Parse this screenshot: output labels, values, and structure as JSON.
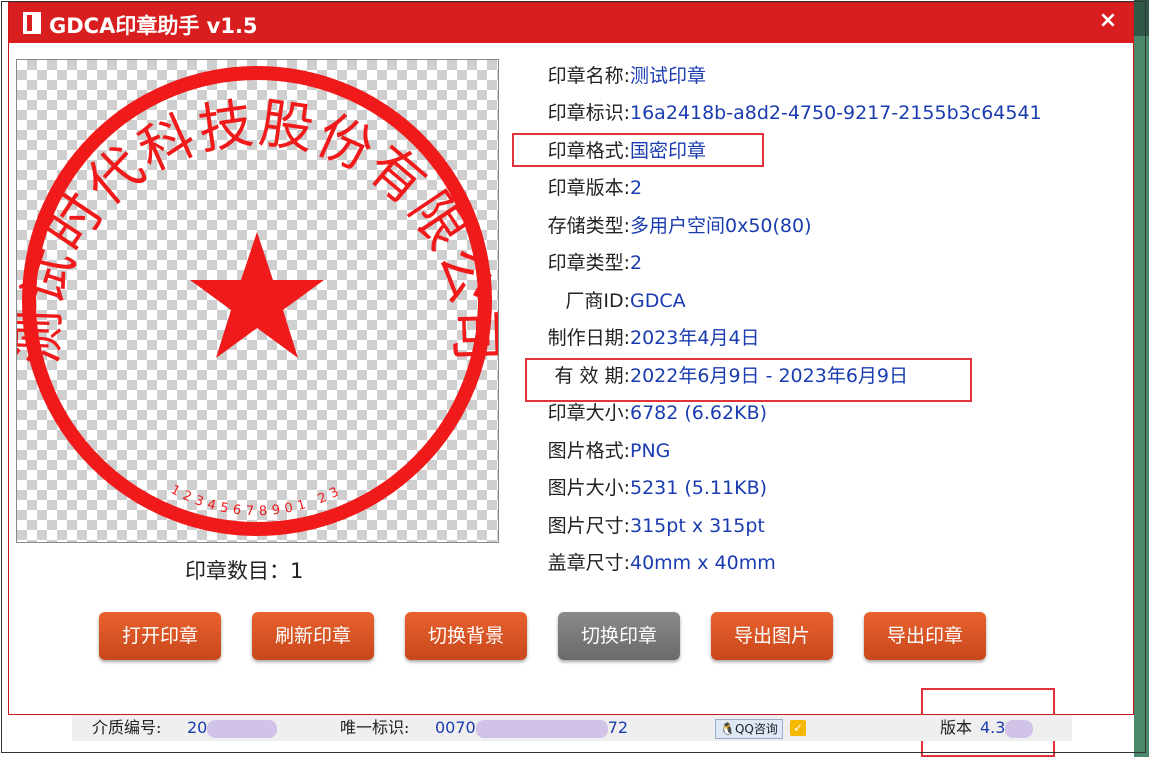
{
  "window": {
    "title": "GDCA印章助手 v1.5",
    "close_glyph": "×"
  },
  "stamp": {
    "outer_text": "测试时代科技股份有限公司",
    "serial": "12345678901 23",
    "count_label": "印章数目：1",
    "color": "#f01a1a"
  },
  "info": [
    {
      "label": "印章名称:",
      "value": "测试印章"
    },
    {
      "label": "印章标识:",
      "value": "16a2418b-a8d2-4750-9217-2155b3c64541"
    },
    {
      "label": "印章格式:",
      "value": "国密印章"
    },
    {
      "label": "印章版本:",
      "value": "2"
    },
    {
      "label": "存储类型:",
      "value": "多用户空间0x50(80)"
    },
    {
      "label": "印章类型:",
      "value": "2"
    },
    {
      "label": "厂商ID:",
      "value": "GDCA"
    },
    {
      "label": "制作日期:",
      "value": "2023年4月4日"
    },
    {
      "label": "有 效 期:",
      "value": "2022年6月9日 - 2023年6月9日"
    },
    {
      "label": "印章大小:",
      "value": "6782 (6.62KB)"
    },
    {
      "label": "图片格式:",
      "value": "PNG"
    },
    {
      "label": "图片大小:",
      "value": "5231 (5.11KB)"
    },
    {
      "label": "图片尺寸:",
      "value": "315pt x 315pt"
    },
    {
      "label": "盖章尺寸:",
      "value": "40mm x 40mm"
    }
  ],
  "buttons": {
    "open": "打开印章",
    "refresh": "刷新印章",
    "switch_bg": "切换背景",
    "switch_stamp": "切换印章",
    "export_image": "导出图片",
    "export_stamp": "导出印章"
  },
  "statusbar": {
    "media_label": "介质编号:",
    "media_value": "20",
    "uid_label": "唯一标识:",
    "uid_prefix": "0070",
    "uid_suffix": "72",
    "qq_label": "QQ咨询",
    "version_label": "版本",
    "version_value": "4.3"
  },
  "colors": {
    "title_bar": "#d81e1e",
    "button": "#d9531f",
    "button_disabled": "#777777",
    "value_text": "#1a3cb0",
    "highlight": "#e0343a"
  }
}
